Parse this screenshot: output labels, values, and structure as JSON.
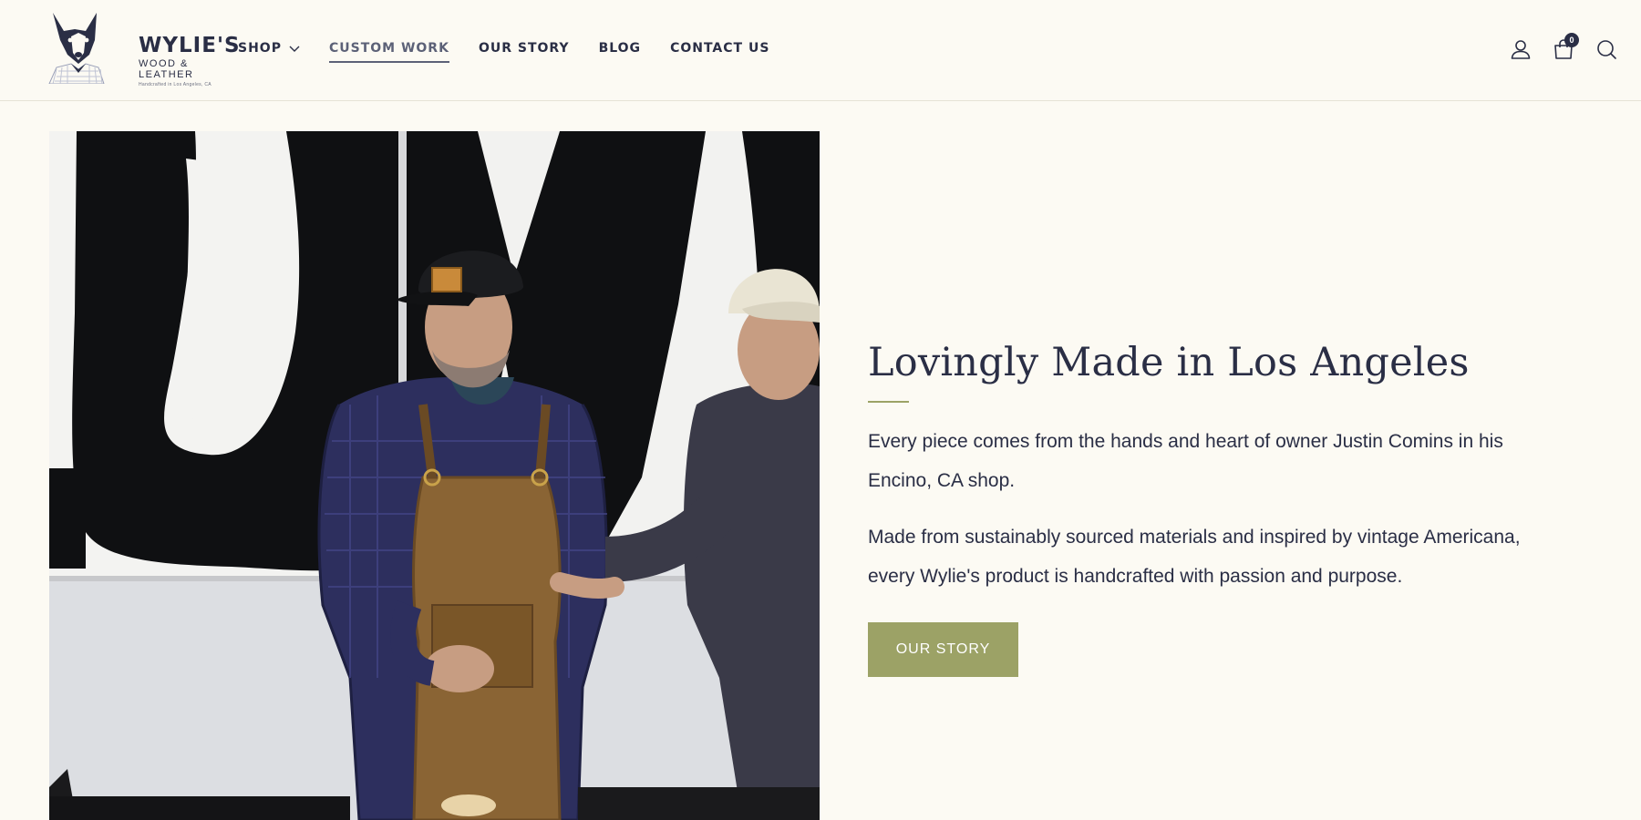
{
  "brand": {
    "name": "WYLIE'S",
    "subtitle": "WOOD & LEATHER",
    "tagline": "Handcrafted in Los Angeles, CA"
  },
  "nav": {
    "items": [
      {
        "label": "SHOP",
        "has_dropdown": true
      },
      {
        "label": "CUSTOM WORK",
        "active": true
      },
      {
        "label": "OUR STORY"
      },
      {
        "label": "BLOG"
      },
      {
        "label": "CONTACT US"
      }
    ]
  },
  "header_icons": {
    "account": "user-icon",
    "cart": "shopping-bag-icon",
    "cart_count": "0",
    "search": "search-icon"
  },
  "hero": {
    "photo_alt": "Owner Justin Comins in leather apron beside another man in a trucker cap",
    "heading": "Lovingly Made in Los Angeles",
    "paragraphs": [
      "Every piece comes from the hands and heart of owner Justin Comins in his Encino, CA shop.",
      "Made from sustainably sourced materials and inspired by vintage Americana, every Wylie's product is handcrafted with passion and purpose."
    ],
    "button_label": "OUR STORY"
  },
  "colors": {
    "background": "#fcfaf3",
    "text": "#2a2e45",
    "accent": "#9ca266",
    "nav_active": "#5c6177"
  }
}
